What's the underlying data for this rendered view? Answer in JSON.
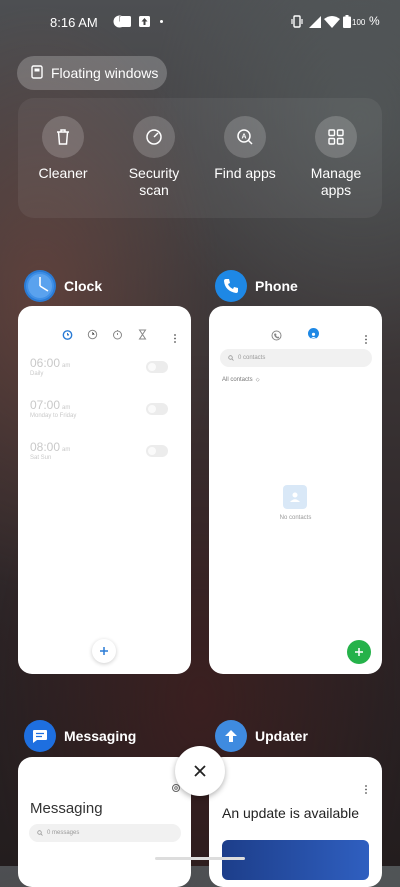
{
  "status_bar": {
    "time": "8:16 AM",
    "battery": "100",
    "battery_suffix": "%"
  },
  "floating_windows": {
    "label": "Floating windows"
  },
  "quick_actions": [
    {
      "label": "Cleaner",
      "icon": "trash-icon"
    },
    {
      "label": "Security scan",
      "icon": "gauge-icon"
    },
    {
      "label": "Find apps",
      "icon": "find-apps-icon"
    },
    {
      "label": "Manage apps",
      "icon": "grid-icon"
    }
  ],
  "apps": {
    "clock": {
      "name": "Clock",
      "alarms": [
        {
          "time": "06:00",
          "ampm": "am",
          "repeat": "Daily"
        },
        {
          "time": "07:00",
          "ampm": "am",
          "repeat": "Monday to Friday"
        },
        {
          "time": "08:00",
          "ampm": "am",
          "repeat": "Sat Sun"
        }
      ]
    },
    "phone": {
      "name": "Phone",
      "search_placeholder": "0 contacts",
      "filter": "All contacts",
      "empty_label": "No contacts"
    },
    "messaging": {
      "name": "Messaging",
      "title": "Messaging",
      "search_placeholder": "0 messages"
    },
    "updater": {
      "name": "Updater",
      "title": "An update is available"
    }
  },
  "colors": {
    "clock_accent": "#2a7bd5",
    "phone_blue": "#1e88e5",
    "phone_fab": "#25b24a",
    "messaging_blue": "#1e6fe0",
    "updater_blue": "#3f8be0"
  }
}
